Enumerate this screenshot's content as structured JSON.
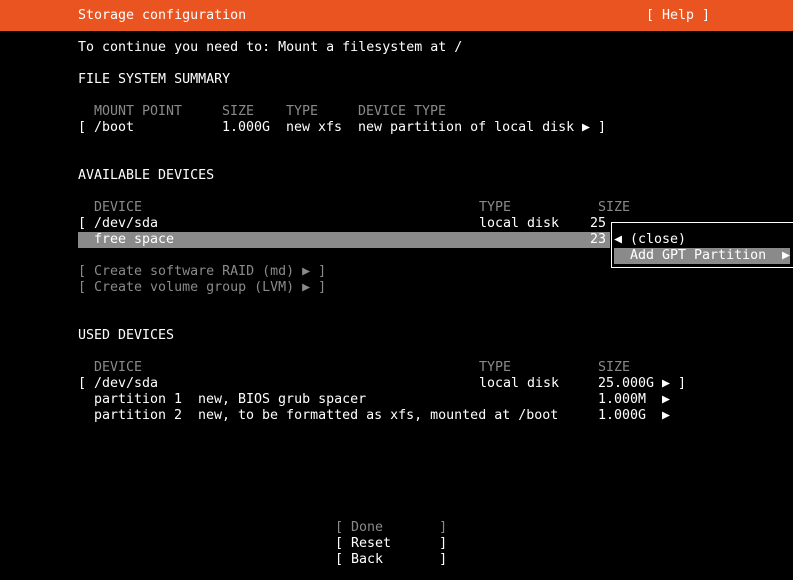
{
  "header": {
    "title": "Storage configuration",
    "help": "[ Help ]"
  },
  "intro": "To continue you need to: Mount a filesystem at /",
  "fs_summary": {
    "heading": "FILE SYSTEM SUMMARY",
    "columns": {
      "mount_point": "MOUNT POINT",
      "size": "SIZE",
      "type": "TYPE",
      "device_type": "DEVICE TYPE"
    },
    "row": {
      "bracket_open": "[",
      "mount_point": "/boot",
      "size": "1.000G",
      "type": "new xfs",
      "device_type": "new partition of local disk",
      "arrow": "▶ ]"
    }
  },
  "available": {
    "heading": "AVAILABLE DEVICES",
    "columns": {
      "device": "DEVICE",
      "type": "TYPE",
      "size": "SIZE"
    },
    "sda": {
      "bracket_open": "[",
      "device": "/dev/sda",
      "type": "local disk",
      "size": "25"
    },
    "free": {
      "device": "free space",
      "size": "23"
    },
    "actions": {
      "raid": "[ Create software RAID (md) ▶ ]",
      "lvm": "[ Create volume group (LVM) ▶ ]"
    }
  },
  "popup": {
    "close": "◀ (close)",
    "add_gpt": "Add GPT Partition",
    "add_gpt_arrow": "▶"
  },
  "used": {
    "heading": "USED DEVICES",
    "columns": {
      "device": "DEVICE",
      "type": "TYPE",
      "size": "SIZE"
    },
    "sda": {
      "bracket_open": "[",
      "device": "/dev/sda",
      "type": "local disk",
      "size": "25.000G",
      "arrow": "▶ ]"
    },
    "partitions": [
      {
        "name": "partition 1",
        "desc": "new, BIOS grub spacer",
        "size": "1.000M",
        "arrow": "▶"
      },
      {
        "name": "partition 2",
        "desc": "new, to be formatted as xfs, mounted at /boot",
        "size": "1.000G",
        "arrow": "▶"
      }
    ]
  },
  "buttons": {
    "done": "[ Done       ]",
    "reset": "[ Reset      ]",
    "back": "[ Back       ]"
  },
  "colors": {
    "header_bg": "#e95420",
    "highlight": "#8a8a8a",
    "disabled_text": "#8a8a8a"
  }
}
